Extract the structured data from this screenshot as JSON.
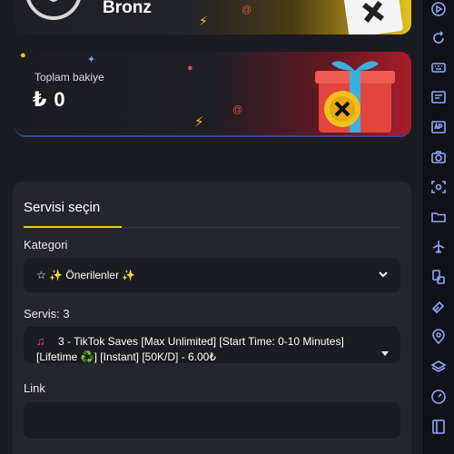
{
  "rank": {
    "name": "Bronz"
  },
  "balance": {
    "label": "Toplam bakiye",
    "value": "₺ 0"
  },
  "service_panel": {
    "tab": "Servisi seçin",
    "category_label": "Kategori",
    "category_value": "☆ ✨ Önerilenler ✨",
    "service_label": "Servis: 3",
    "service_icon": "♫",
    "service_value_line1": "3 - TikTok Saves [Max Unlimited] [Start Time: 0-10 Minutes]",
    "service_value_line2": "[Lifetime ♻️] [Instant] [50K/D] - 6.00₺",
    "link_label": "Link",
    "link_value": ""
  },
  "sidebar": {
    "icons": [
      "play-icon",
      "refresh-icon",
      "keyboard-icon",
      "screenshot-icon",
      "apk-icon",
      "camera-icon",
      "screen-record-icon",
      "folder-icon",
      "airplane-icon",
      "multi-window-icon",
      "eraser-icon",
      "location-icon",
      "layers-icon",
      "gauge-icon",
      "sidebar-toggle-icon"
    ]
  },
  "colors": {
    "accent": "#f2c11b",
    "sidebar_icon": "#8fa6ff",
    "panel_bg": "#25262d",
    "input_bg": "#1b1c21"
  }
}
